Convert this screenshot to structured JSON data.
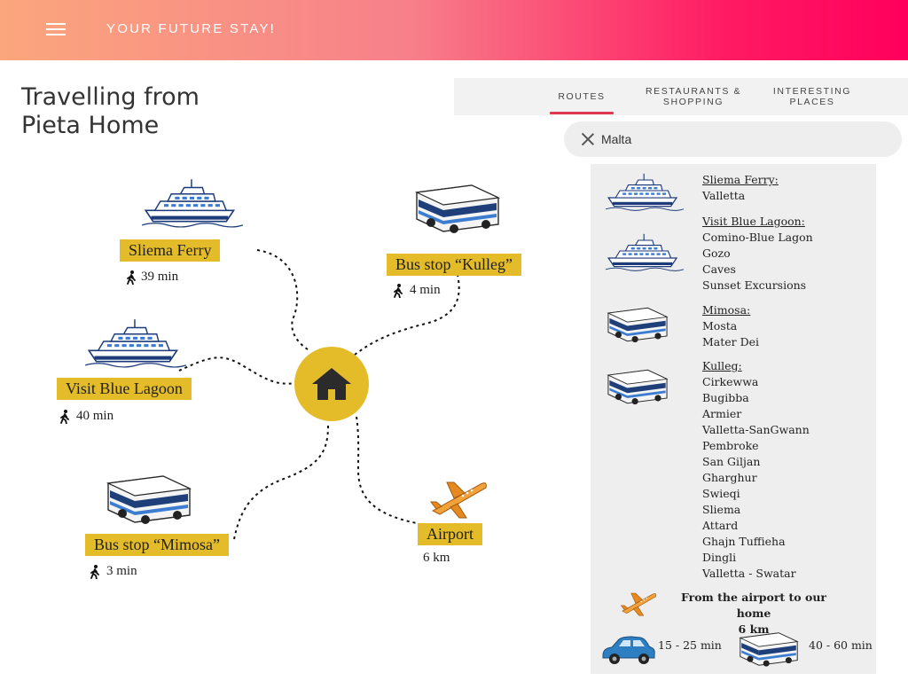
{
  "header": {
    "brand": "YOUR FUTURE STAY!"
  },
  "title": {
    "line1": "Travelling from",
    "line2": "Pieta Home"
  },
  "tabs": [
    {
      "label": "ROUTES",
      "active": true
    },
    {
      "label": "RESTAURANTS & SHOPPING",
      "line1": "RESTAURANTS &",
      "line2": "SHOPPING",
      "active": false
    },
    {
      "label": "INTERESTING PLACES",
      "line1": "INTERESTING",
      "line2": "PLACES",
      "active": false
    }
  ],
  "search": {
    "value": "Malta"
  },
  "map": {
    "sliema": {
      "label": "Sliema Ferry",
      "time": "39 min",
      "icon": "ferry-icon"
    },
    "kulleg": {
      "label": "Bus stop “Kulleg”",
      "time": "4 min",
      "icon": "bus-icon"
    },
    "lagoon": {
      "label": "Visit Blue Lagoon",
      "time": "40 min",
      "icon": "ferry-icon"
    },
    "mimosa": {
      "label": "Bus stop “Mimosa”",
      "time": "3 min",
      "icon": "bus-icon"
    },
    "airport": {
      "label": "Airport",
      "time": "6 km",
      "icon": "airplane-icon"
    },
    "home": {
      "icon": "home-icon"
    }
  },
  "panel": {
    "routes": [
      {
        "heading": "Sliema Ferry:",
        "items": [
          "Valletta"
        ],
        "icon": "ferry-icon"
      },
      {
        "heading": "Visit Blue Lagoon:",
        "items": [
          "Comino-Blue Lagon",
          "Gozo",
          "Caves",
          "Sunset Excursions"
        ],
        "icon": "ferry-icon"
      },
      {
        "heading": "Mimosa:",
        "items": [
          "Mosta",
          "Mater Dei"
        ],
        "icon": "bus-icon"
      },
      {
        "heading": "Kulleg:",
        "items": [
          "Cirkewwa",
          "Bugibba",
          "Armier",
          "Valletta-SanGwann",
          "Pembroke",
          "San Giljan",
          "Gharghur",
          "Swieqi",
          "Sliema",
          "Attard",
          "Ghajn Tuffieha",
          "Dingli",
          "Valletta - Swatar"
        ],
        "icon": "bus-icon"
      }
    ],
    "airport_note": {
      "line1": "From the airport to our home",
      "line2": "6 km"
    },
    "car_time": "15 - 25 min",
    "bus_time": "40 - 60 min"
  },
  "colors": {
    "accent": "#e4bc2a",
    "tab_underline": "#e0394f",
    "header_start": "#fba67d",
    "header_end": "#ff005c"
  }
}
